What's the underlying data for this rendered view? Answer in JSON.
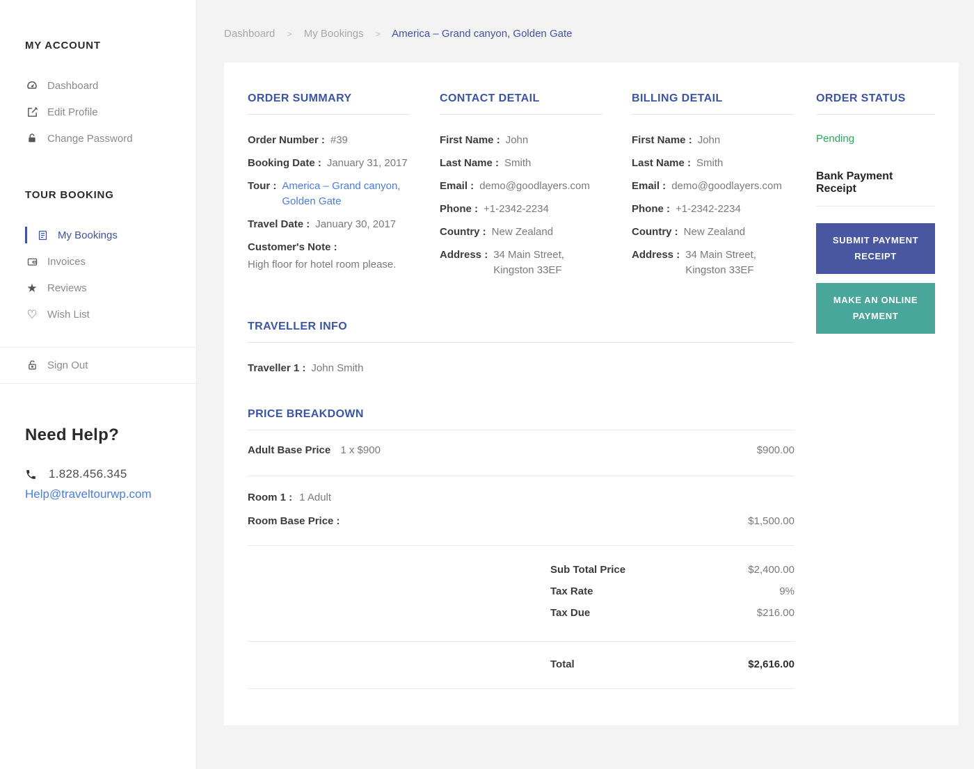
{
  "colors": {
    "accent_blue": "#3b54a4",
    "link_blue": "#4a7de0",
    "status_green": "#2fa85a",
    "button_blue": "#48579f",
    "button_teal": "#49a69a",
    "page_background": "#f3f3f3"
  },
  "sidebar": {
    "account_title": "MY ACCOUNT",
    "account_items": [
      {
        "icon": "dashboard-icon",
        "label": "Dashboard"
      },
      {
        "icon": "edit-icon",
        "label": "Edit Profile"
      },
      {
        "icon": "lock-icon",
        "label": "Change Password"
      }
    ],
    "booking_title": "TOUR BOOKING",
    "booking_items": [
      {
        "icon": "bookings-icon",
        "label": "My Bookings",
        "active": true
      },
      {
        "icon": "wallet-icon",
        "label": "Invoices"
      },
      {
        "icon": "star-icon",
        "label": "Reviews"
      },
      {
        "icon": "heart-icon",
        "label": "Wish List"
      }
    ],
    "sign_out": "Sign Out",
    "help_title": "Need Help?",
    "help_phone": "1.828.456.345",
    "help_email": "Help@traveltourwp.com"
  },
  "breadcrumb": {
    "separator": ">",
    "items": [
      "Dashboard",
      "My Bookings",
      "America – Grand canyon, Golden Gate"
    ]
  },
  "order_summary": {
    "title": "ORDER SUMMARY",
    "order_number_label": "Order Number :",
    "order_number": "#39",
    "booking_date_label": "Booking Date :",
    "booking_date": "January 31, 2017",
    "tour_label": "Tour :",
    "tour": "America – Grand canyon, Golden Gate",
    "travel_date_label": "Travel Date :",
    "travel_date": "January 30, 2017",
    "customer_note_label": "Customer's Note :",
    "customer_note": "High floor for hotel room please."
  },
  "contact_detail": {
    "title": "CONTACT DETAIL",
    "rows": [
      {
        "label": "First Name :",
        "value": "John"
      },
      {
        "label": "Last Name :",
        "value": "Smith"
      },
      {
        "label": "Email :",
        "value": "demo@goodlayers.com"
      },
      {
        "label": "Phone :",
        "value": "+1-2342-2234"
      },
      {
        "label": "Country :",
        "value": "New Zealand"
      },
      {
        "label": "Address :",
        "value": "34 Main Street, Kingston 33EF"
      }
    ]
  },
  "billing_detail": {
    "title": "BILLING DETAIL",
    "rows": [
      {
        "label": "First Name :",
        "value": "John"
      },
      {
        "label": "Last Name :",
        "value": "Smith"
      },
      {
        "label": "Email :",
        "value": "demo@goodlayers.com"
      },
      {
        "label": "Phone :",
        "value": "+1-2342-2234"
      },
      {
        "label": "Country :",
        "value": "New Zealand"
      },
      {
        "label": "Address :",
        "value": "34 Main Street, Kingston 33EF"
      }
    ]
  },
  "order_status": {
    "title": "ORDER STATUS",
    "status": "Pending",
    "receipt_title": "Bank Payment Receipt",
    "submit_button": "SUBMIT PAYMENT RECEIPT",
    "pay_button": "MAKE AN ONLINE PAYMENT"
  },
  "traveller_info": {
    "title": "TRAVELLER INFO",
    "label": "Traveller 1 :",
    "value": "John Smith"
  },
  "price_breakdown": {
    "title": "PRICE BREAKDOWN",
    "adult_label": "Adult Base Price",
    "adult_qty": "1 x $900",
    "adult_amount": "$900.00",
    "room_label": "Room 1 :",
    "room_value": "1 Adult",
    "room_price_label": "Room Base Price :",
    "room_price_amount": "$1,500.00",
    "subtotal_label": "Sub Total Price",
    "subtotal": "$2,400.00",
    "tax_rate_label": "Tax Rate",
    "tax_rate": "9%",
    "tax_due_label": "Tax Due",
    "tax_due": "$216.00",
    "total_label": "Total",
    "total": "$2,616.00"
  }
}
